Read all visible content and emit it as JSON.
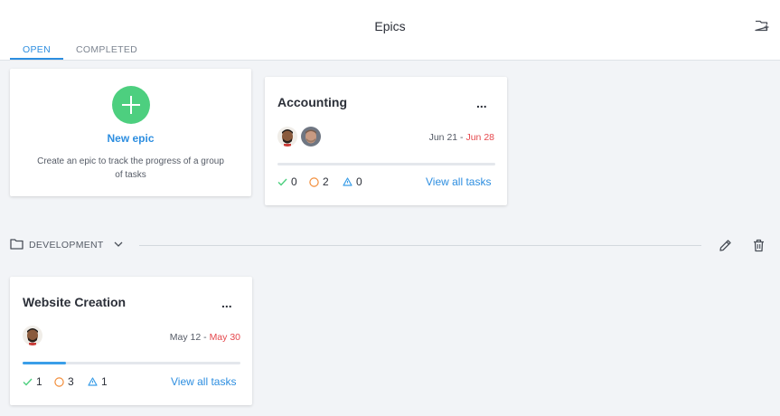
{
  "header": {
    "title": "Epics",
    "tabs": [
      {
        "label": "OPEN",
        "active": true
      },
      {
        "label": "COMPLETED",
        "active": false
      }
    ]
  },
  "new_epic": {
    "label": "New epic",
    "description": "Create an epic to track the progress of a group of tasks"
  },
  "epics": [
    {
      "name": "Accounting",
      "more": "...",
      "start": "Jun 21",
      "separator": " - ",
      "end": "Jun 28",
      "progress": 0,
      "done": "0",
      "open": "2",
      "warning": "0",
      "view_all": "View all tasks"
    },
    {
      "name": "Website Creation",
      "more": "...",
      "start": "May 12",
      "separator": " - ",
      "end": "May 30",
      "progress": 0.2,
      "done": "1",
      "open": "3",
      "warning": "1",
      "view_all": "View all tasks"
    }
  ],
  "group": {
    "name": "DEVELOPMENT"
  },
  "colors": {
    "accent": "#2d8ee0",
    "add_green": "#4dcf7f",
    "done_green": "#4dcf7f",
    "open_orange": "#f28c38",
    "warning_blue": "#3a9ee8",
    "due_red": "#e5484d"
  }
}
